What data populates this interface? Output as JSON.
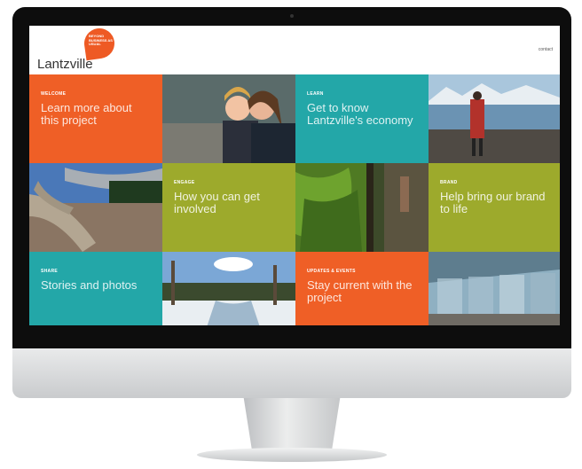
{
  "site": {
    "badge_text": "BEYOND BUSINESS AS USUAL",
    "logo": "Lantzville",
    "contact_link": "contact"
  },
  "tiles": [
    {
      "label": "WELCOME",
      "title": "Learn more about this project",
      "color": "#ef5f26"
    },
    {
      "label": "LEARN",
      "title": "Get to know Lantzville's economy",
      "color": "#23a7a8"
    },
    {
      "label": "ENGAGE",
      "title": "How you can get involved",
      "color": "#9daa2c"
    },
    {
      "label": "BRAND",
      "title": "Help bring our brand to life",
      "color": "#9daa2c"
    },
    {
      "label": "SHARE",
      "title": "Stories and photos",
      "color": "#23a7a8"
    },
    {
      "label": "UPDATES & EVENTS",
      "title": "Stay current with the project",
      "color": "#ef5f26"
    }
  ],
  "photos": [
    {
      "icon": "child-with-mother-photo"
    },
    {
      "icon": "woman-on-beach-photo"
    },
    {
      "icon": "driftwood-beach-photo"
    },
    {
      "icon": "moss-forest-photo"
    },
    {
      "icon": "snowy-river-photo"
    },
    {
      "icon": "glass-building-photo"
    }
  ]
}
